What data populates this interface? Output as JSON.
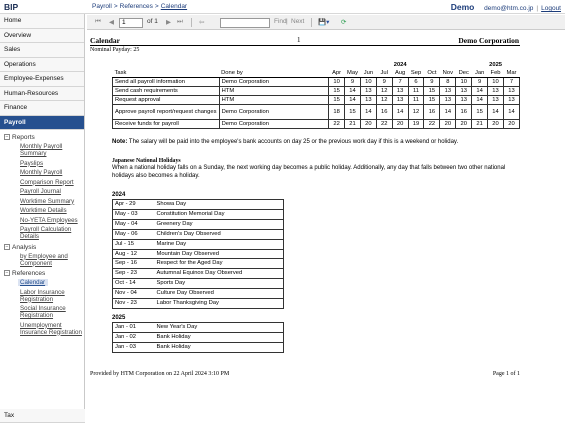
{
  "app": {
    "brand": "BIP",
    "user_label": "Demo",
    "email": "demo@htm.co.jp",
    "logout": "Logout"
  },
  "breadcrumb": [
    "Payroll",
    "References",
    "Calendar"
  ],
  "sidebar": {
    "top_items": [
      "Home",
      "Overview",
      "Sales",
      "Operations",
      "Employee-Expenses",
      "Human-Resources",
      "Finance",
      "Payroll"
    ],
    "groups": [
      {
        "label": "Reports",
        "items": [
          "Monthly Payroll Summary",
          "Payslips",
          "Monthly Payroll",
          "Comparison Report",
          "Payroll Journal",
          "Worktime Summary",
          "Worktime Details",
          "No-YETA Employees",
          "Payroll Calculation Details"
        ]
      },
      {
        "label": "Analysis",
        "items": [
          "by Employee and Component"
        ]
      },
      {
        "label": "References",
        "items": [
          "Calendar",
          "Labor Insurance Registration",
          "Social Insurance Registration",
          "Unemployment Insurance Registration"
        ]
      }
    ],
    "bottom_item": "Tax"
  },
  "toolbar": {
    "page_value": "1",
    "of_label": "of 1",
    "find_label": "Find",
    "next_label": "Next",
    "separator": "|"
  },
  "report": {
    "title": "Calendar",
    "page_number": "1",
    "company": "Demo Corporation",
    "nominal_payday": "Nominal Payday: 25",
    "years": [
      "2024",
      "2025"
    ],
    "columns": [
      "Task",
      "Done by"
    ],
    "months": [
      "Apr",
      "May",
      "Jun",
      "Jul",
      "Aug",
      "Sep",
      "Oct",
      "Nov",
      "Dec",
      "Jan",
      "Feb",
      "Mar"
    ],
    "rows": [
      {
        "task": "Send all payroll information",
        "by": "Demo Corporation",
        "days": [
          "10",
          "9",
          "10",
          "9",
          "7",
          "6",
          "9",
          "8",
          "10",
          "9",
          "10",
          "7"
        ]
      },
      {
        "task": "Send cash requirements",
        "by": "HTM",
        "days": [
          "15",
          "14",
          "13",
          "12",
          "13",
          "11",
          "15",
          "13",
          "13",
          "14",
          "13",
          "13"
        ]
      },
      {
        "task": "Request approval",
        "by": "HTM",
        "days": [
          "15",
          "14",
          "13",
          "12",
          "13",
          "11",
          "15",
          "13",
          "13",
          "14",
          "13",
          "13"
        ]
      },
      {
        "task": "Approve payroll report/request changes",
        "by": "Demo Corporation",
        "days": [
          "18",
          "15",
          "14",
          "16",
          "14",
          "12",
          "16",
          "14",
          "16",
          "15",
          "14",
          "14"
        ]
      },
      {
        "task": "Receive funds for payroll",
        "by": "Demo Corporation",
        "days": [
          "22",
          "21",
          "20",
          "22",
          "20",
          "19",
          "22",
          "20",
          "20",
          "21",
          "20",
          "20"
        ]
      }
    ],
    "note_label": "Note:",
    "note_text": "The salary will be paid into the employee's bank accounts on day 25 or the previous work day if this is a weekend or holiday.",
    "holidays_title": "Japanese National Holidays",
    "holidays_desc": "When a national holiday falls on a Sunday, the next working day becomes a public holiday. Additionally, any day that falls between two other national holidays also becomes a holiday.",
    "holidays_2024_year": "2024",
    "holidays_2024": [
      {
        "date": "Apr - 29",
        "name": "Showa Day"
      },
      {
        "date": "May - 03",
        "name": "Constitution Memorial Day"
      },
      {
        "date": "May - 04",
        "name": "Greenery Day"
      },
      {
        "date": "May - 06",
        "name": "Children's Day Observed"
      },
      {
        "date": "Jul - 15",
        "name": "Marine Day"
      },
      {
        "date": "Aug - 12",
        "name": "Mountain Day Observed"
      },
      {
        "date": "Sep - 16",
        "name": "Respect for the Aged Day"
      },
      {
        "date": "Sep - 23",
        "name": "Autumnal Equinox Day Observed"
      },
      {
        "date": "Oct - 14",
        "name": "Sports Day"
      },
      {
        "date": "Nov - 04",
        "name": "Culture Day Observed"
      },
      {
        "date": "Nov - 23",
        "name": "Labor Thanksgiving Day"
      }
    ],
    "holidays_2025_year": "2025",
    "holidays_2025": [
      {
        "date": "Jan - 01",
        "name": "New Year's Day"
      },
      {
        "date": "Jan - 02",
        "name": "Bank Holiday"
      },
      {
        "date": "Jan - 03",
        "name": "Bank Holiday"
      }
    ],
    "footer_left": "Provided by HTM Corporation on 22 April 2024 3:10 PM",
    "footer_right": "Page 1 of 1"
  },
  "colors": {
    "accent": "#26508f",
    "brand": "#1c2f55",
    "link": "#1c3c7a"
  }
}
